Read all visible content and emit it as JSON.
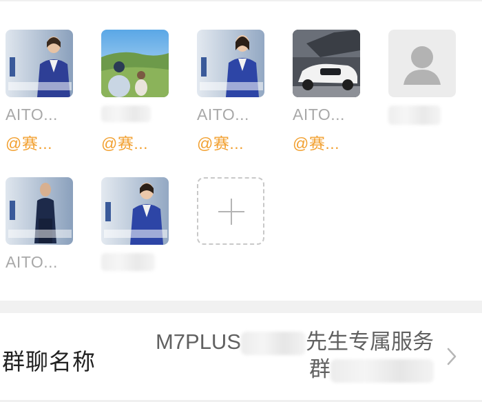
{
  "members": [
    {
      "name": "AITO...",
      "sub": "@赛...",
      "avatar": "woman-in-blue-suit-photo"
    },
    {
      "name": "",
      "sub": "@赛...",
      "avatar": "landscape-photo",
      "name_blurred": true
    },
    {
      "name": "AITO...",
      "sub": "@赛...",
      "avatar": "woman-in-blue-suit-photo"
    },
    {
      "name": "AITO...",
      "sub": "@赛...",
      "avatar": "white-suv-photo"
    },
    {
      "name": "",
      "sub": "",
      "avatar": "default-person-icon",
      "name_blurred": true
    },
    {
      "name": "AITO...",
      "sub": "",
      "avatar": "man-in-navy-jacket-photo"
    },
    {
      "name": "",
      "sub": "",
      "avatar": "woman-in-blue-suit-photo",
      "name_blurred": true
    }
  ],
  "add_member": {
    "icon": "plus-icon"
  },
  "group_name": {
    "label": "群聊名称",
    "value_part1": "M7PLUS",
    "value_part2": "先生专属服务",
    "value_part3": "群",
    "chevron": "chevron-right-icon"
  },
  "colors": {
    "name_gray": "#a8a8a8",
    "sub_orange": "#f2a030",
    "label_dark": "#222222",
    "value_gray": "#606060",
    "divider": "#f1f1f1"
  }
}
